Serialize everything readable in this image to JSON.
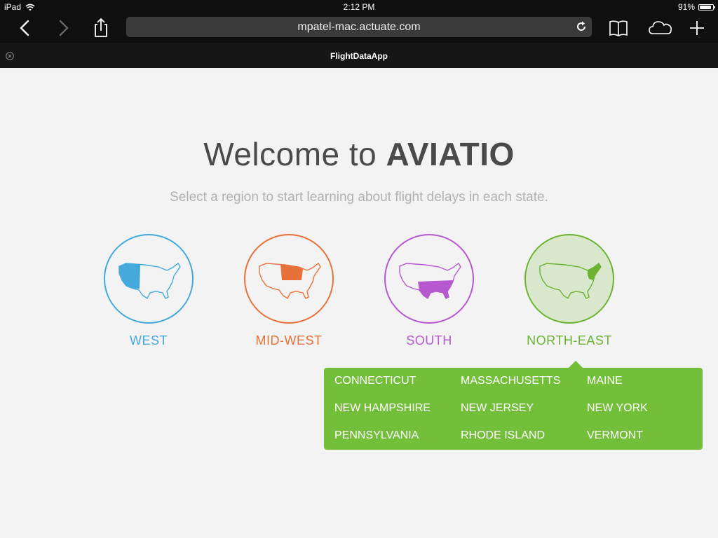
{
  "status_bar": {
    "device": "iPad",
    "time": "2:12 PM",
    "battery": "91%",
    "battery_level": 0.91
  },
  "toolbar": {
    "url": "mpatel-mac.actuate.com",
    "icons": [
      "chevron-left-icon",
      "chevron-right-icon",
      "share-icon",
      "reload-icon",
      "bookmarks-icon",
      "cloud-tabs-icon",
      "plus-icon"
    ]
  },
  "tab": {
    "title": "FlightDataApp"
  },
  "page": {
    "welcome_prefix": "Welcome to ",
    "brand": "AVIATIO",
    "subtitle": "Select a region to start learning about flight delays in each state."
  },
  "regions": [
    {
      "label": "WEST",
      "color": "#45a9dc",
      "selected": false
    },
    {
      "label": "MID-WEST",
      "color": "#e8713a",
      "selected": false
    },
    {
      "label": "SOUTH",
      "color": "#b658cf",
      "selected": false
    },
    {
      "label": "NORTH-EAST",
      "color": "#6cb332",
      "selected": true,
      "selected_bg": "#d9e8cc"
    }
  ],
  "states_panel": {
    "color": "#74bf39",
    "states": [
      "CONNECTICUT",
      "MASSACHUSETTS",
      "MAINE",
      "NEW HAMPSHIRE",
      "NEW JERSEY",
      "NEW YORK",
      "PENNSYLVANIA",
      "RHODE ISLAND",
      "VERMONT"
    ]
  }
}
